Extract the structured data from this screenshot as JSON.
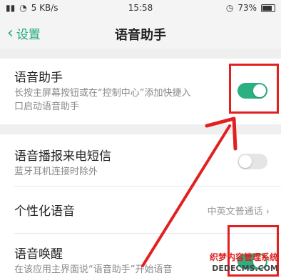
{
  "statusbar": {
    "network": "5 KB/s",
    "time": "15:58",
    "battery": "73%"
  },
  "navbar": {
    "back_label": "设置",
    "title": "语音助手"
  },
  "settings": {
    "voice_assistant": {
      "title": "语音助手",
      "subtitle_line1": "长按主屏幕按钮或在“控制中心”添加快捷入",
      "subtitle_line2": "口启动语音助手",
      "enabled": true
    },
    "sms_announce": {
      "title": "语音播报来电短信",
      "subtitle": "蓝牙耳机连接时除外",
      "enabled": false
    },
    "personalized_voice": {
      "title": "个性化语音",
      "value": "中英文普通话",
      "chevron": "›"
    },
    "voice_wakeup": {
      "title": "语音唤醒",
      "subtitle": "在该应用主界面说“语音助手”开始语音",
      "enabled": true
    }
  },
  "watermark": {
    "line1": "织梦内容管理系统",
    "line2": "DEDECMS.COM"
  },
  "colors": {
    "accent": "#1fa87b",
    "toggle_on": "#2bb07f",
    "highlight": "#e32020"
  }
}
